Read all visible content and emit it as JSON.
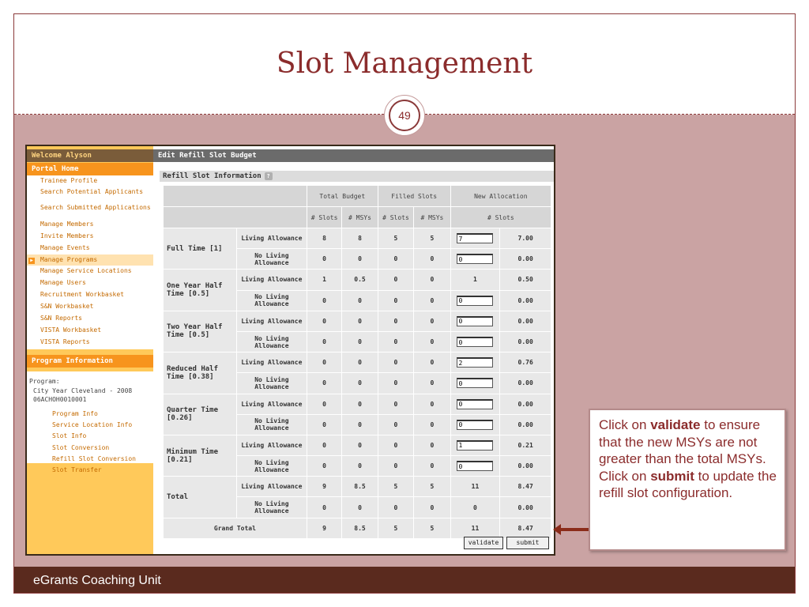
{
  "slide": {
    "title": "Slot Management",
    "page_number": "49",
    "footer": "eGrants Coaching Unit"
  },
  "sidebar": {
    "welcome": "Welcome Alyson",
    "portal_home": "Portal Home",
    "items": [
      "Trainee Profile",
      "Search Potential Applicants",
      "Search Submitted Applications",
      "Manage Members",
      "Invite Members",
      "Manage Events",
      "Manage Programs",
      "Manage Service Locations",
      "Manage Users",
      "Recruitment Workbasket",
      "S&N Workbasket",
      "S&N Reports",
      "VISTA Workbasket",
      "VISTA Reports"
    ],
    "program_information_header": "Program Information",
    "program_label": "Program:",
    "program_value": "City Year Cleveland - 2008 06ACHOH0010001",
    "program_links": [
      "Program Info",
      "Service Location Info",
      "Slot Info",
      "Slot Conversion",
      "Refill Slot Conversion",
      "Slot Transfer"
    ]
  },
  "main": {
    "header": "Edit Refill Slot Budget",
    "section": "Refill Slot Information",
    "help_icon": "?",
    "col_groups": [
      "Total Budget",
      "Filled Slots",
      "New Allocation"
    ],
    "sub_cols": [
      "# Slots",
      "# MSYs",
      "# Slots",
      "# MSYs",
      "# Slots"
    ],
    "sub_labels": {
      "living": "Living Allowance",
      "no_living": "No Living Allowance"
    },
    "rows": [
      {
        "label": "Full Time [1]",
        "living": {
          "slots": "8",
          "msys": "8",
          "filled_slots": "5",
          "filled_msys": "5",
          "new_slots": "7",
          "new_is_input": true,
          "new_msys": "7.00"
        },
        "no_living": {
          "slots": "0",
          "msys": "0",
          "filled_slots": "0",
          "filled_msys": "0",
          "new_slots": "0",
          "new_is_input": true,
          "new_msys": "0.00"
        }
      },
      {
        "label": "One Year Half Time [0.5]",
        "living": {
          "slots": "1",
          "msys": "0.5",
          "filled_slots": "0",
          "filled_msys": "0",
          "new_slots": "1",
          "new_is_input": false,
          "new_msys": "0.50"
        },
        "no_living": {
          "slots": "0",
          "msys": "0",
          "filled_slots": "0",
          "filled_msys": "0",
          "new_slots": "0",
          "new_is_input": true,
          "new_msys": "0.00"
        }
      },
      {
        "label": "Two Year Half Time [0.5]",
        "living": {
          "slots": "0",
          "msys": "0",
          "filled_slots": "0",
          "filled_msys": "0",
          "new_slots": "0",
          "new_is_input": true,
          "new_msys": "0.00"
        },
        "no_living": {
          "slots": "0",
          "msys": "0",
          "filled_slots": "0",
          "filled_msys": "0",
          "new_slots": "0",
          "new_is_input": true,
          "new_msys": "0.00"
        }
      },
      {
        "label": "Reduced Half Time [0.38]",
        "living": {
          "slots": "0",
          "msys": "0",
          "filled_slots": "0",
          "filled_msys": "0",
          "new_slots": "2",
          "new_is_input": true,
          "new_msys": "0.76"
        },
        "no_living": {
          "slots": "0",
          "msys": "0",
          "filled_slots": "0",
          "filled_msys": "0",
          "new_slots": "0",
          "new_is_input": true,
          "new_msys": "0.00"
        }
      },
      {
        "label": "Quarter Time [0.26]",
        "living": {
          "slots": "0",
          "msys": "0",
          "filled_slots": "0",
          "filled_msys": "0",
          "new_slots": "0",
          "new_is_input": true,
          "new_msys": "0.00"
        },
        "no_living": {
          "slots": "0",
          "msys": "0",
          "filled_slots": "0",
          "filled_msys": "0",
          "new_slots": "0",
          "new_is_input": true,
          "new_msys": "0.00"
        }
      },
      {
        "label": "Minimum Time [0.21]",
        "living": {
          "slots": "0",
          "msys": "0",
          "filled_slots": "0",
          "filled_msys": "0",
          "new_slots": "1",
          "new_is_input": true,
          "new_msys": "0.21"
        },
        "no_living": {
          "slots": "0",
          "msys": "0",
          "filled_slots": "0",
          "filled_msys": "0",
          "new_slots": "0",
          "new_is_input": true,
          "new_msys": "0.00"
        }
      },
      {
        "label": "Total",
        "living": {
          "slots": "9",
          "msys": "8.5",
          "filled_slots": "5",
          "filled_msys": "5",
          "new_slots": "11",
          "new_is_input": false,
          "new_msys": "8.47"
        },
        "no_living": {
          "slots": "0",
          "msys": "0",
          "filled_slots": "0",
          "filled_msys": "0",
          "new_slots": "0",
          "new_is_input": false,
          "new_msys": "0.00"
        }
      }
    ],
    "grand_total": {
      "label": "Grand Total",
      "slots": "9",
      "msys": "8.5",
      "filled_slots": "5",
      "filled_msys": "5",
      "new_slots": "11",
      "new_msys": "8.47"
    },
    "buttons": {
      "validate": "validate",
      "submit": "submit"
    }
  },
  "callout": {
    "t1": "Click on ",
    "b1": "validate",
    "t2": " to ensure that the new MSYs are not greater than the total MSYs. Click on ",
    "b2": "submit",
    "t3": " to update the refill slot configuration."
  },
  "colors": {
    "accent": "#8b2c2c",
    "content_bg": "#caa3a3",
    "footer_bg": "#5a2a1e",
    "sidebar_bg": "#ffc95a",
    "sidebar_header": "#f7941d"
  }
}
